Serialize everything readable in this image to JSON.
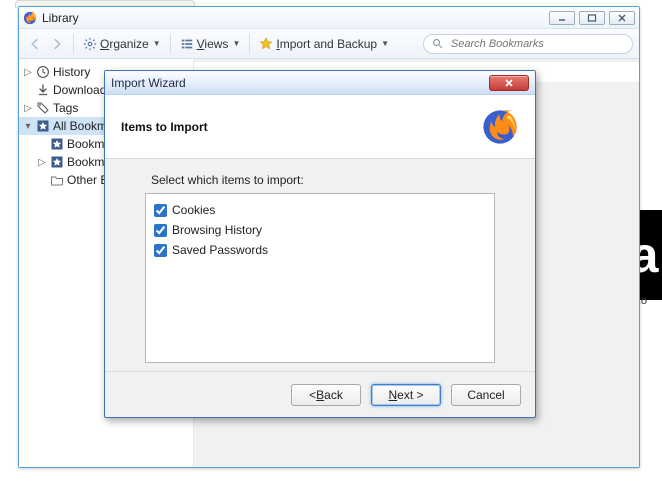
{
  "library": {
    "title": "Library",
    "toolbar": {
      "organize_html": "<u>O</u>rganize",
      "views_html": "<u>V</u>iews",
      "import_html": "<u>I</u>mport and Backup"
    },
    "search": {
      "placeholder": "Search Bookmarks"
    },
    "tree": {
      "history": "History",
      "downloads": "Downloads",
      "tags": "Tags",
      "all_bookmarks": "All Bookmarks",
      "bookmarks_toolbar": "Bookmarks Toolbar",
      "bookmarks_menu": "Bookmarks Menu",
      "other_bookmarks": "Other Bookmarks"
    }
  },
  "wizard": {
    "title": "Import Wizard",
    "header_title": "Items to Import",
    "prompt": "Select which items to import:",
    "options": {
      "cookies": {
        "label": "Cookies",
        "checked": true
      },
      "history": {
        "label": "Browsing History",
        "checked": true
      },
      "passwords": {
        "label": "Saved Passwords",
        "checked": true
      }
    },
    "buttons": {
      "back_html": "&lt; <u>B</u>ack",
      "next_html": "<u>N</u>ext &gt;",
      "cancel": "Cancel"
    }
  },
  "bg": {
    "amazon_label": "mazo"
  }
}
